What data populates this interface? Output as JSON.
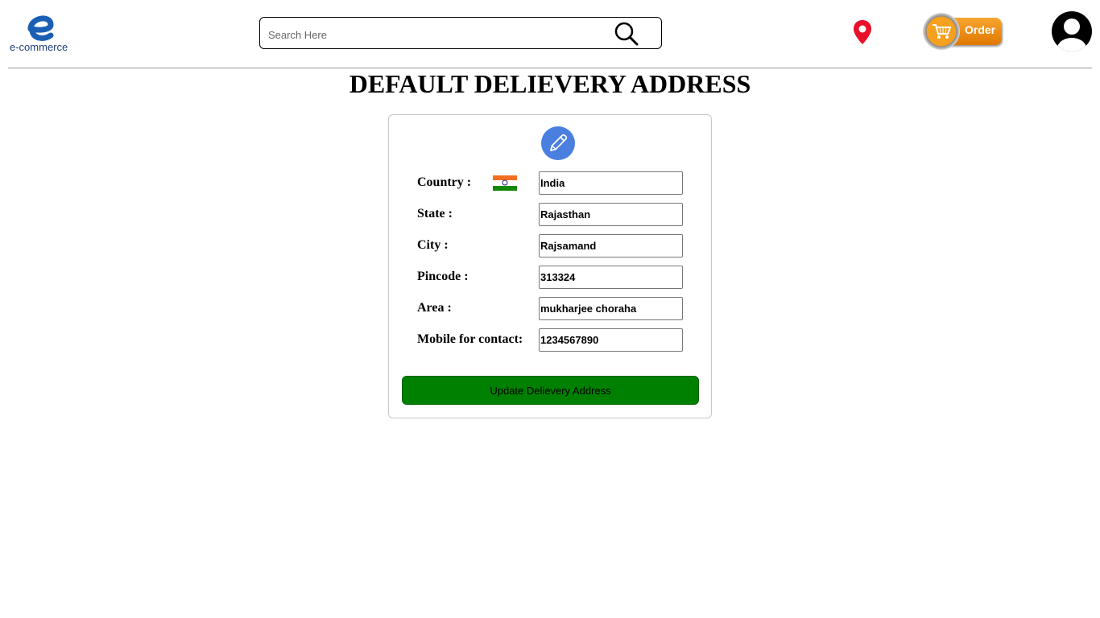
{
  "header": {
    "logo_text": "e-commerce",
    "search": {
      "placeholder": "Search Here",
      "value": ""
    },
    "order_label": "Order"
  },
  "page": {
    "title": "DEFAULT DELIEVERY ADDRESS"
  },
  "form": {
    "country": {
      "label": "Country :",
      "value": "India"
    },
    "state": {
      "label": "State :",
      "value": "Rajasthan"
    },
    "city": {
      "label": "City :",
      "value": "Rajsamand"
    },
    "pincode": {
      "label": "Pincode :",
      "value": "313324"
    },
    "area": {
      "label": "Area :",
      "value": "mukharjee choraha"
    },
    "mobile": {
      "label": "Mobile for contact:",
      "value": "1234567890"
    },
    "submit_label": "Update Delievery Address"
  },
  "icons": {
    "logo": "ecommerce-logo-icon",
    "search": "search-icon",
    "location": "location-pin-icon",
    "order": "shopping-cart-icon",
    "profile": "user-avatar-icon",
    "edit": "pencil-icon",
    "flag": "india-flag-icon"
  },
  "colors": {
    "brand_blue": "#1a5fb4",
    "pin_red": "#e8102a",
    "order_orange": "#f39c12",
    "edit_blue": "#4a7fe0",
    "button_green": "#008000"
  }
}
